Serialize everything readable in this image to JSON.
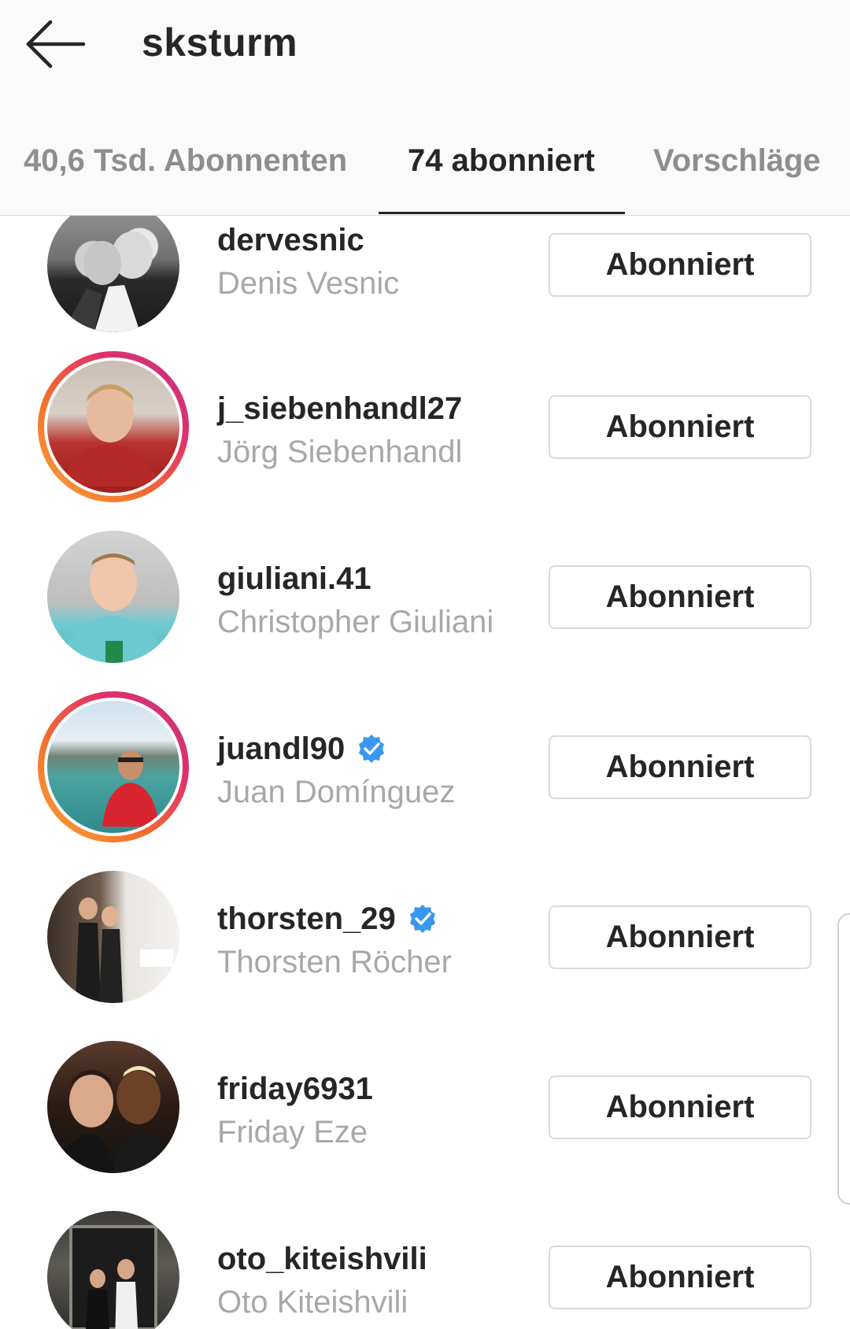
{
  "header": {
    "title": "sksturm",
    "back_icon": "arrow-left-icon"
  },
  "tabs": [
    {
      "label": "40,6 Tsd. Abonnenten",
      "active": false
    },
    {
      "label": "74 abonniert",
      "active": true
    },
    {
      "label": "Vorschläge",
      "active": false
    }
  ],
  "colors": {
    "text_primary": "#262626",
    "text_secondary": "#a8a8a8",
    "verified_blue": "#3897f0",
    "story_ring_start": "#f9a33b",
    "story_ring_end": "#c13584"
  },
  "following": [
    {
      "username": "dervesnic",
      "full_name": "Denis Vesnic",
      "verified": false,
      "story_ring": false,
      "button_label": "Abonniert"
    },
    {
      "username": "j_siebenhandl27",
      "full_name": "Jörg Siebenhandl",
      "verified": false,
      "story_ring": true,
      "button_label": "Abonniert"
    },
    {
      "username": "giuliani.41",
      "full_name": "Christopher Giuliani",
      "verified": false,
      "story_ring": false,
      "button_label": "Abonniert"
    },
    {
      "username": "juandl90",
      "full_name": "Juan Domínguez",
      "verified": true,
      "story_ring": true,
      "button_label": "Abonniert"
    },
    {
      "username": "thorsten_29",
      "full_name": "Thorsten Röcher",
      "verified": true,
      "story_ring": false,
      "button_label": "Abonniert"
    },
    {
      "username": "friday6931",
      "full_name": "Friday Eze",
      "verified": false,
      "story_ring": false,
      "button_label": "Abonniert"
    },
    {
      "username": "oto_kiteishvili",
      "full_name": "Oto Kiteishvili",
      "verified": false,
      "story_ring": false,
      "button_label": "Abonniert"
    }
  ]
}
